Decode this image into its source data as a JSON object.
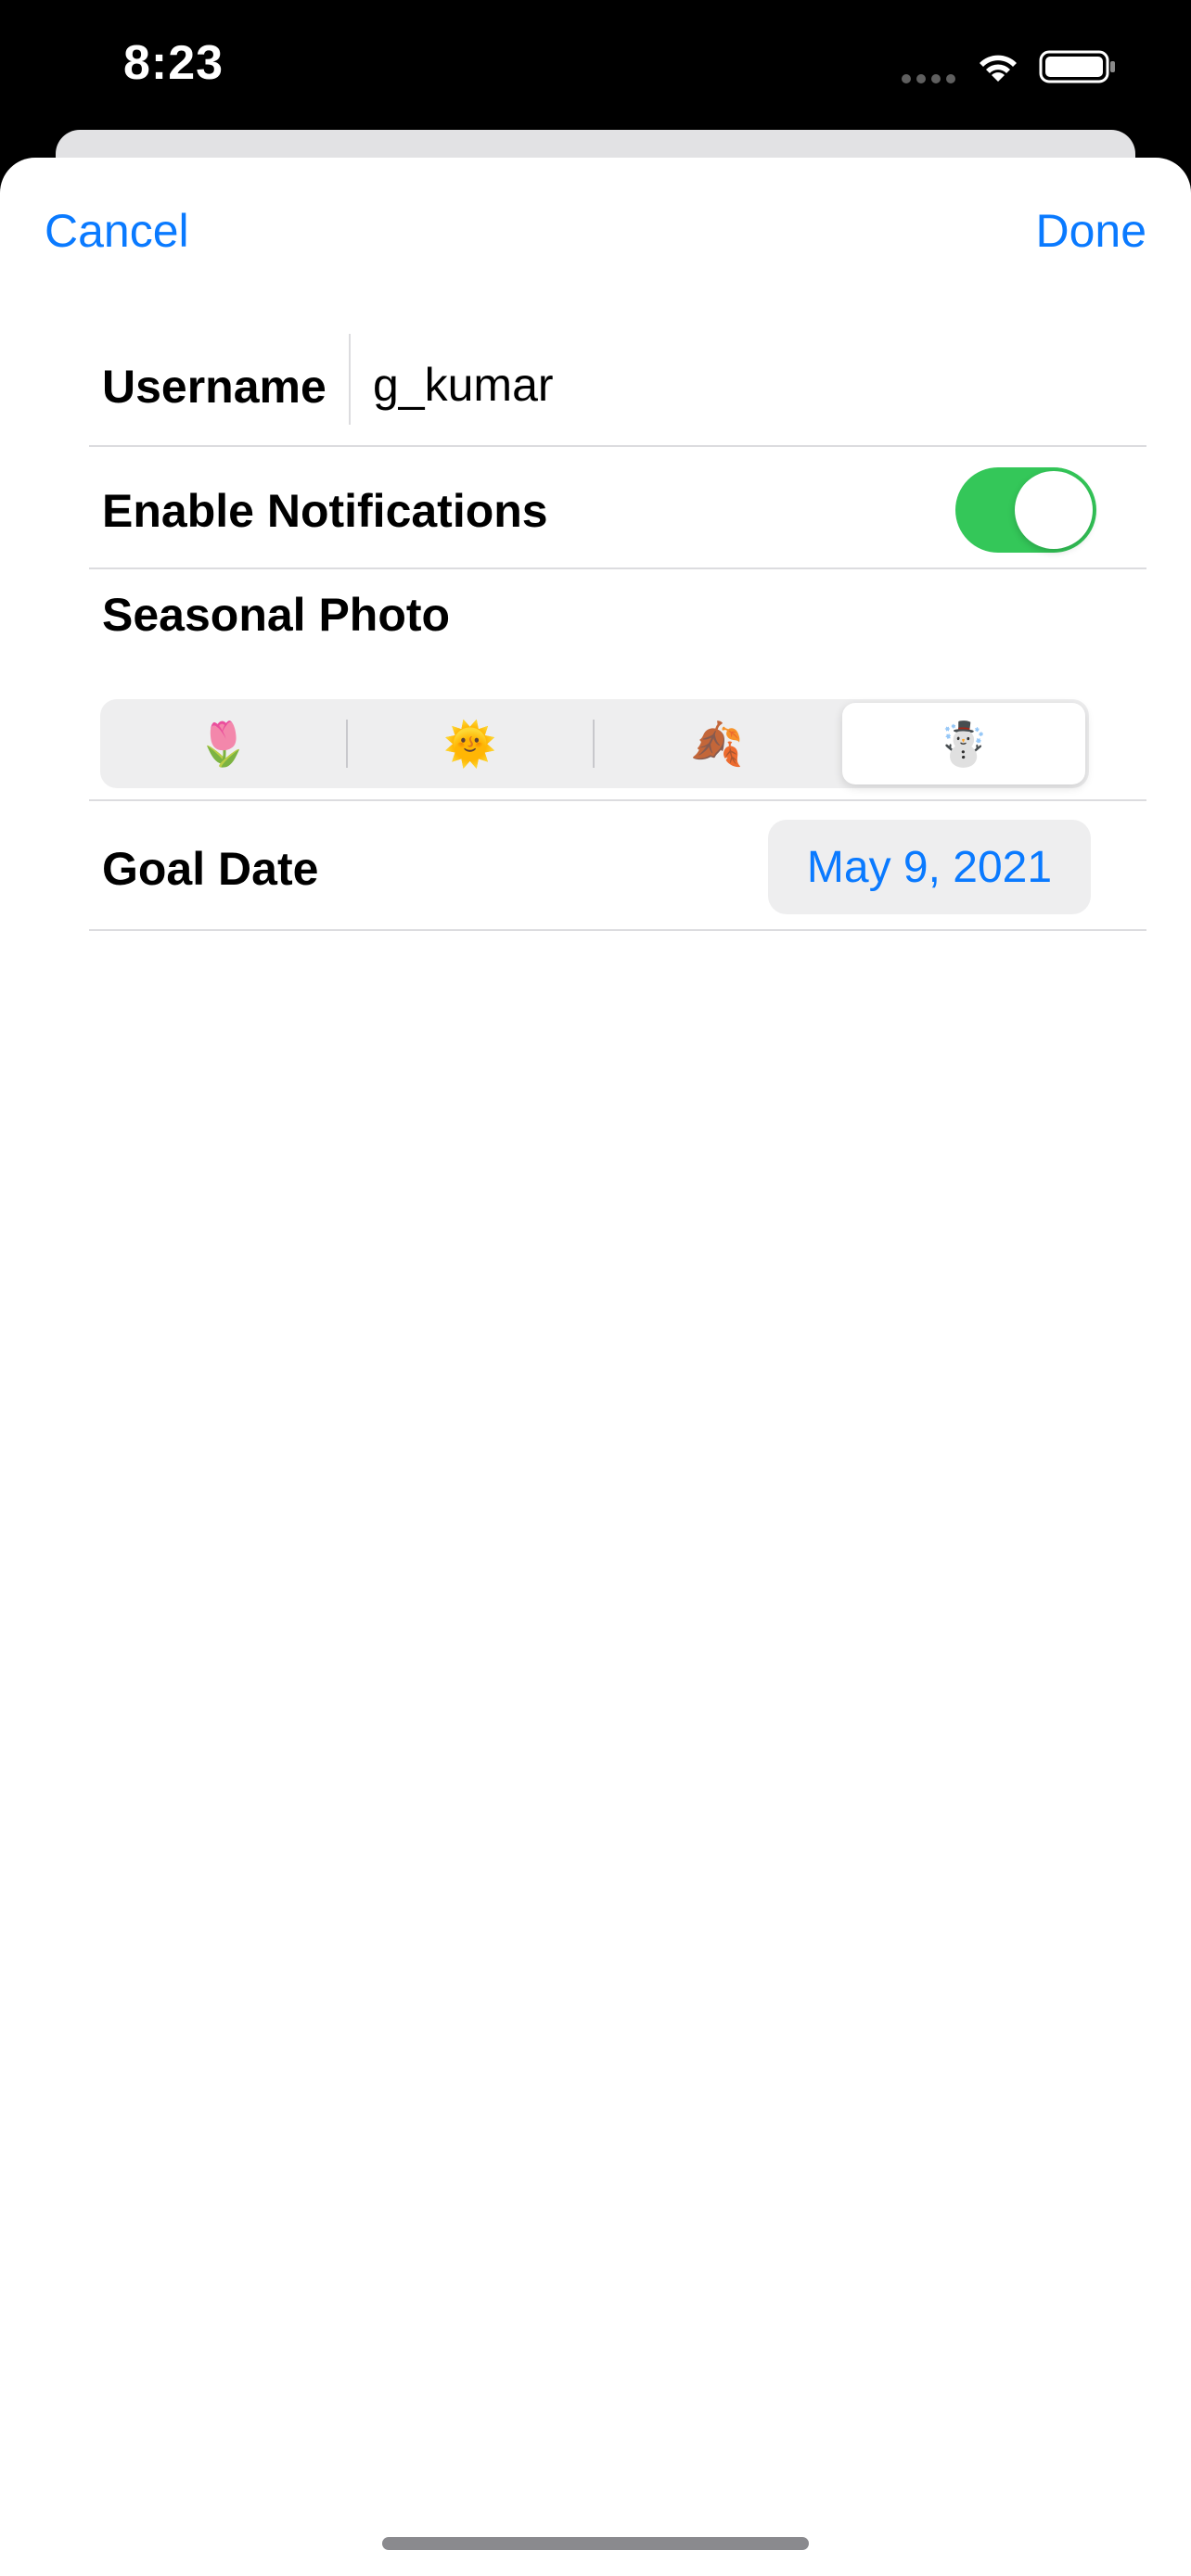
{
  "status_bar": {
    "time": "8:23"
  },
  "nav": {
    "cancel_label": "Cancel",
    "done_label": "Done"
  },
  "form": {
    "username": {
      "label": "Username",
      "value": "g_kumar"
    },
    "notifications": {
      "label": "Enable Notifications",
      "enabled": true
    },
    "seasonal_photo": {
      "label": "Seasonal Photo",
      "options": [
        {
          "icon": "tulip-icon",
          "glyph": "🌷"
        },
        {
          "icon": "sun-icon",
          "glyph": "🌞"
        },
        {
          "icon": "fallen-leaf-icon",
          "glyph": "🍂"
        },
        {
          "icon": "snowman-icon",
          "glyph": "☃️"
        }
      ],
      "selected_index": 3
    },
    "goal_date": {
      "label": "Goal Date",
      "value": "May 9, 2021"
    }
  },
  "colors": {
    "accent": "#0a7aff",
    "toggle_on": "#34c759"
  }
}
